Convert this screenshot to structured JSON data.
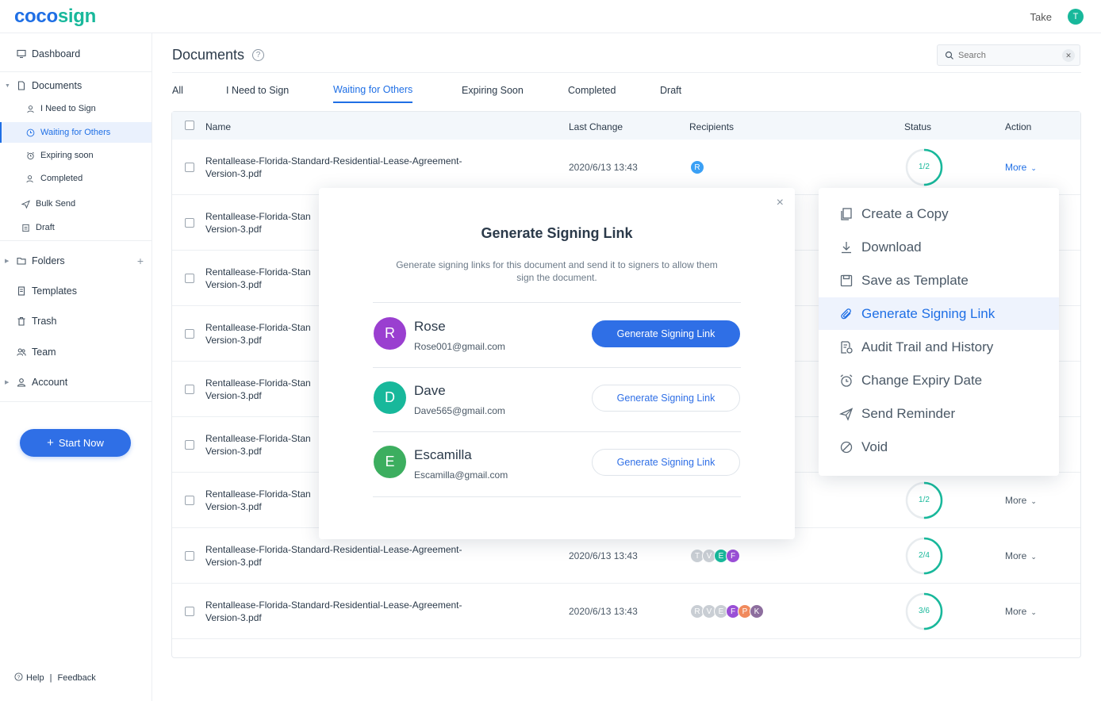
{
  "app": {
    "logo_part1": "coco",
    "logo_part2": "sign",
    "user_name": "Take",
    "user_initial": "T"
  },
  "sidebar": {
    "dashboard": "Dashboard",
    "documents": "Documents",
    "i_need_to_sign": "I Need to Sign",
    "waiting_for_others": "Waiting for Others",
    "expiring_soon": "Expiring soon",
    "completed": "Completed",
    "bulk_send": "Bulk Send",
    "draft": "Draft",
    "folders": "Folders",
    "templates": "Templates",
    "trash": "Trash",
    "team": "Team",
    "account": "Account",
    "start_now": "Start Now",
    "help": "Help",
    "divider": "|",
    "feedback": "Feedback"
  },
  "main": {
    "title": "Documents",
    "help_glyph": "?",
    "search_placeholder": "Search",
    "tabs": [
      "All",
      "I Need to Sign",
      "Waiting for Others",
      "Expiring Soon",
      "Completed",
      "Draft"
    ],
    "active_tab": "Waiting for Others"
  },
  "table": {
    "headers": {
      "name": "Name",
      "last_change": "Last Change",
      "recipients": "Recipients",
      "status": "Status",
      "action": "Action"
    },
    "rows": [
      {
        "name": "Rentallease-Florida-Standard-Residential-Lease-Agreement-Version-3.pdf",
        "date": "2020/6/13  13:43",
        "status": "1/2",
        "action": "More"
      },
      {
        "name": "Rentallease-Florida-Stan Version-3.pdf"
      },
      {
        "name": "Rentallease-Florida-Stan Version-3.pdf"
      },
      {
        "name": "Rentallease-Florida-Stan Version-3.pdf"
      },
      {
        "name": "Rentallease-Florida-Stan Version-3.pdf"
      },
      {
        "name": "Rentallease-Florida-Stan Version-3.pdf"
      },
      {
        "name": "Rentallease-Florida-Stan Version-3.pdf",
        "status": "1/2",
        "action": "More"
      },
      {
        "name": "Rentallease-Florida-Standard-Residential-Lease-Agreement-Version-3.pdf",
        "date": "2020/6/13  13:43",
        "status": "2/4",
        "action": "More"
      },
      {
        "name": "Rentallease-Florida-Standard-Residential-Lease-Agreement-Version-3.pdf",
        "date": "2020/6/13  13:43",
        "status": "3/6",
        "action": "More"
      }
    ],
    "row_name_lines": [
      [
        "Rentallease-Florida-Standard-Residential-Lease-Agreement-",
        "Version-3.pdf"
      ],
      [
        "Rentallease-Florida-Stan",
        "Version-3.pdf"
      ]
    ],
    "recipient_sets": [
      [
        {
          "initial": "R",
          "color": "#3aa0f5"
        }
      ],
      [
        {
          "initial": "T",
          "color": "#c9ced4"
        },
        {
          "initial": "V",
          "color": "#c9ced4"
        },
        {
          "initial": "E",
          "color": "#18b89b"
        },
        {
          "initial": "F",
          "color": "#9a4fd6"
        }
      ],
      [
        {
          "initial": "R",
          "color": "#c9ced4"
        },
        {
          "initial": "V",
          "color": "#c9ced4"
        },
        {
          "initial": "E",
          "color": "#c9ced4"
        },
        {
          "initial": "F",
          "color": "#9a4fd6"
        },
        {
          "initial": "P",
          "color": "#f08a5d"
        },
        {
          "initial": "K",
          "color": "#8d6e9e"
        }
      ]
    ],
    "status_progress": [
      0.5,
      0.5,
      0.5,
      0.5
    ]
  },
  "modal": {
    "title": "Generate Signing Link",
    "description": "Generate signing links for this document and send it to signers to allow them sign the document.",
    "close_glyph": "×",
    "signers": [
      {
        "initial": "R",
        "name": "Rose",
        "email": "Rose001@gmail.com",
        "button": "Generate Signing Link",
        "color": "#9a3fd0"
      },
      {
        "initial": "D",
        "name": "Dave",
        "email": "Dave565@gmail.com",
        "button": "Generate Signing Link",
        "color": "#18b89b"
      },
      {
        "initial": "E",
        "name": "Escamilla",
        "email": "Escamilla@gmail.com",
        "button": "Generate Signing Link",
        "color": "#3cae5f"
      }
    ]
  },
  "menu": {
    "items": [
      "Create a Copy",
      "Download",
      "Save as Template",
      "Generate Signing Link",
      "Audit Trail and History",
      "Change Expiry Date",
      "Send Reminder",
      "Void"
    ],
    "highlighted": "Generate Signing Link"
  }
}
